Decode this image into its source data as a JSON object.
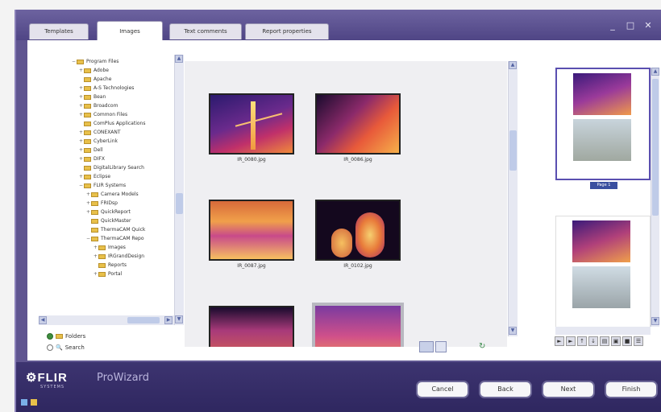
{
  "tabs": [
    {
      "label": "Templates",
      "active": false
    },
    {
      "label": "Images",
      "active": true
    },
    {
      "label": "Text comments",
      "active": false
    },
    {
      "label": "Report properties",
      "active": false
    }
  ],
  "tree": {
    "items": [
      {
        "label": "Program Files",
        "indent": 0,
        "exp": "-"
      },
      {
        "label": "Adobe",
        "indent": 1,
        "exp": "+"
      },
      {
        "label": "Apache",
        "indent": 1,
        "exp": ""
      },
      {
        "label": "A-S Technologies",
        "indent": 1,
        "exp": "+"
      },
      {
        "label": "Bean",
        "indent": 1,
        "exp": "+"
      },
      {
        "label": "Broadcom",
        "indent": 1,
        "exp": "+"
      },
      {
        "label": "Common Files",
        "indent": 1,
        "exp": "+"
      },
      {
        "label": "ComPlus Applications",
        "indent": 1,
        "exp": ""
      },
      {
        "label": "CONEXANT",
        "indent": 1,
        "exp": "+"
      },
      {
        "label": "CyberLink",
        "indent": 1,
        "exp": "+"
      },
      {
        "label": "Dell",
        "indent": 1,
        "exp": "+"
      },
      {
        "label": "DIFX",
        "indent": 1,
        "exp": "+"
      },
      {
        "label": "DigitalLibrary Search",
        "indent": 1,
        "exp": ""
      },
      {
        "label": "Eclipse",
        "indent": 1,
        "exp": "+"
      },
      {
        "label": "FLIR Systems",
        "indent": 1,
        "exp": "-"
      },
      {
        "label": "Camera Models",
        "indent": 2,
        "exp": "+"
      },
      {
        "label": "FRIDsp",
        "indent": 2,
        "exp": "+"
      },
      {
        "label": "QuickReport",
        "indent": 2,
        "exp": "+"
      },
      {
        "label": "QuickMaster",
        "indent": 2,
        "exp": ""
      },
      {
        "label": "ThermaCAM Quick",
        "indent": 2,
        "exp": ""
      },
      {
        "label": "ThermaCAM Repo",
        "indent": 2,
        "exp": "-"
      },
      {
        "label": "Images",
        "indent": 3,
        "exp": "+"
      },
      {
        "label": "IRGrandDesign",
        "indent": 3,
        "exp": "+"
      },
      {
        "label": "Reports",
        "indent": 3,
        "exp": ""
      },
      {
        "label": "Portal",
        "indent": 3,
        "exp": "+"
      }
    ]
  },
  "view_options": {
    "folders_label": "Folders",
    "search_label": "Search",
    "selected": "Folders"
  },
  "images": [
    {
      "filename": "IR_0080.jpg",
      "scene": "tower"
    },
    {
      "filename": "IR_0086.jpg",
      "scene": "wires"
    },
    {
      "filename": "IR_0087.jpg",
      "scene": "bush"
    },
    {
      "filename": "IR_0102.jpg",
      "scene": "cylinders"
    },
    {
      "filename": "",
      "scene": "structure"
    },
    {
      "filename": "",
      "scene": "gradient"
    }
  ],
  "preview": {
    "selected_label": "Page 1"
  },
  "footer": {
    "brand": "FLIR",
    "brand_sub": "SYSTEMS",
    "product": "ProWizard"
  },
  "buttons": {
    "cancel": "Cancel",
    "back": "Back",
    "next": "Next",
    "finish": "Finish"
  },
  "colors": {
    "chrome": "#5f5590",
    "accent": "#5a4fb0",
    "footer": "#2f2760"
  }
}
